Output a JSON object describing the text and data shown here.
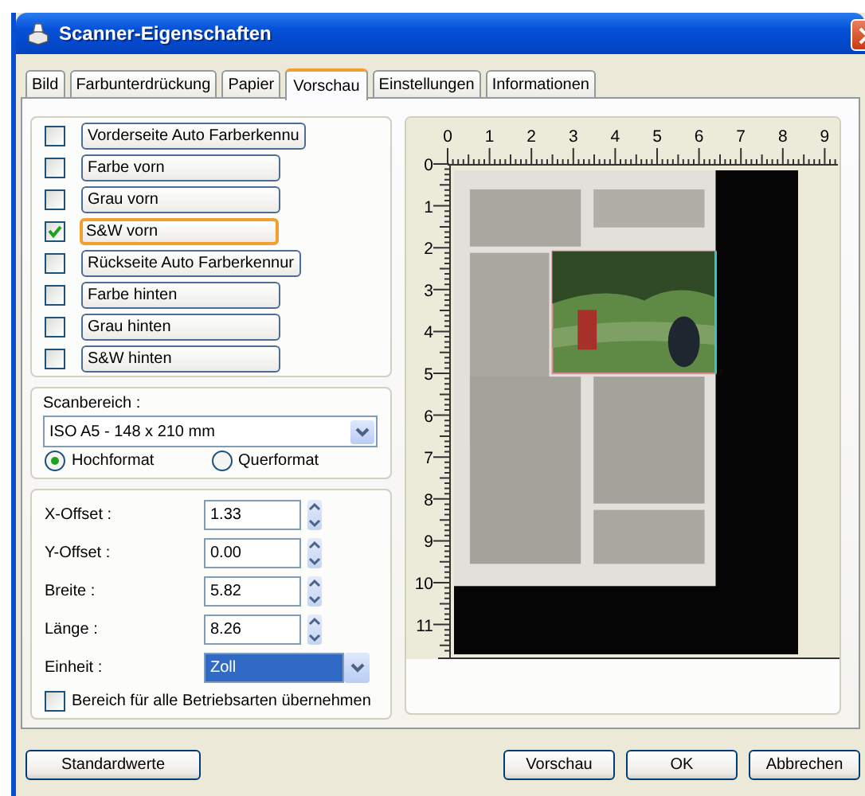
{
  "window": {
    "title": "Scanner-Eigenschaften"
  },
  "tabs": [
    {
      "label": "Bild",
      "selected": false
    },
    {
      "label": "Farbunterdrückung",
      "selected": false
    },
    {
      "label": "Papier",
      "selected": false
    },
    {
      "label": "Vorschau",
      "selected": true
    },
    {
      "label": "Einstellungen",
      "selected": false
    },
    {
      "label": "Informationen",
      "selected": false
    }
  ],
  "preview_modes": [
    {
      "label": "Vorderseite Auto Farberkennu",
      "checked": false,
      "highlighted": false
    },
    {
      "label": "Farbe vorn",
      "checked": false,
      "highlighted": false
    },
    {
      "label": "Grau vorn",
      "checked": false,
      "highlighted": false
    },
    {
      "label": "S&W vorn",
      "checked": true,
      "highlighted": true
    },
    {
      "label": "Rückseite Auto Farberkennur",
      "checked": false,
      "highlighted": false
    },
    {
      "label": "Farbe hinten",
      "checked": false,
      "highlighted": false
    },
    {
      "label": "Grau hinten",
      "checked": false,
      "highlighted": false
    },
    {
      "label": "S&W hinten",
      "checked": false,
      "highlighted": false
    }
  ],
  "scan_area": {
    "label": "Scanbereich :",
    "value": "ISO A5 - 148 x 210 mm",
    "orientations": [
      {
        "label": "Hochformat",
        "selected": true
      },
      {
        "label": "Querformat",
        "selected": false
      }
    ]
  },
  "offsets": [
    {
      "label": "X-Offset :",
      "value": "1.33"
    },
    {
      "label": "Y-Offset :",
      "value": "0.00"
    },
    {
      "label": "Breite :",
      "value": "5.82"
    },
    {
      "label": "Länge :",
      "value": "8.26"
    }
  ],
  "unit": {
    "label": "Einheit :",
    "value": "Zoll"
  },
  "apply_all": {
    "label": "Bereich für alle Betriebsarten übernehmen",
    "checked": false
  },
  "preview": {
    "x_ruler": [
      "0",
      "1",
      "2",
      "3",
      "4",
      "5",
      "6",
      "7",
      "8",
      "9"
    ],
    "y_ruler": [
      "0",
      "1",
      "2",
      "3",
      "4",
      "5",
      "6",
      "7",
      "8",
      "9",
      "10",
      "11"
    ]
  },
  "buttons_left": [
    {
      "label": "Standardwerte"
    }
  ],
  "buttons_right": [
    {
      "label": "Vorschau"
    },
    {
      "label": "OK"
    },
    {
      "label": "Abbrechen"
    }
  ]
}
